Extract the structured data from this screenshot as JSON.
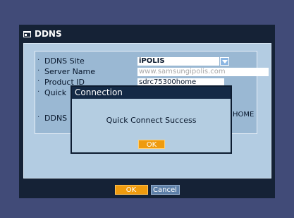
{
  "window": {
    "title": "DDNS",
    "icon": "ddns-window-icon"
  },
  "form": {
    "ddns_site_label": "DDNS Site",
    "ddns_site_value": "iPOLIS",
    "server_name_label": "Server Name",
    "server_name_value": "www.samsungipolis.com",
    "product_id_label": "Product ID",
    "product_id_value": "sdrc75300home",
    "quick_connect_label": "Quick",
    "ddns_address_label": "DDNS",
    "ddns_address_value": "HOME"
  },
  "dialog": {
    "title": "Connection",
    "message": "Quick Connect Success",
    "ok_label": "OK"
  },
  "buttons": {
    "ok_label": "OK",
    "cancel_label": "Cancel"
  },
  "colors": {
    "background": "#414b78",
    "window": "#152236",
    "panel": "#b3cce2",
    "ok_button": "#ef9b0e",
    "cancel_button": "#5d7fa7"
  }
}
